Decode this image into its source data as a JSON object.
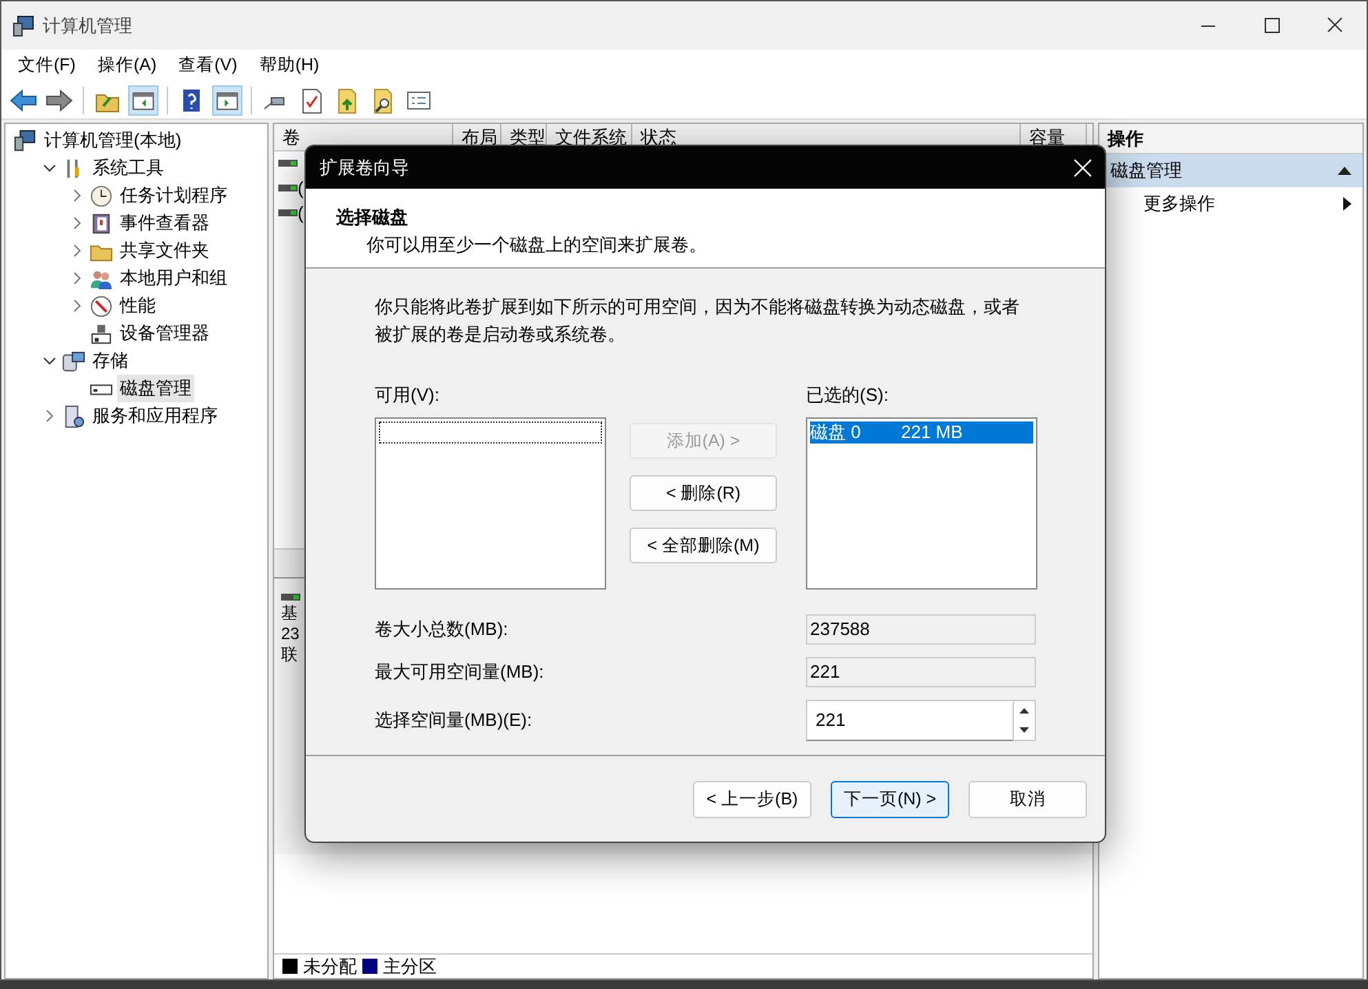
{
  "window": {
    "title": "计算机管理"
  },
  "menu": [
    "文件(F)",
    "操作(A)",
    "查看(V)",
    "帮助(H)"
  ],
  "tree": [
    {
      "label": "计算机管理(本地)",
      "selected": false,
      "children": [
        {
          "label": "系统工具",
          "expanded": true,
          "selected": false,
          "children": [
            {
              "label": "任务计划程序",
              "expanded": false,
              "selected": false
            },
            {
              "label": "事件查看器",
              "expanded": false,
              "selected": false
            },
            {
              "label": "共享文件夹",
              "expanded": false,
              "selected": false
            },
            {
              "label": "本地用户和组",
              "expanded": false,
              "selected": false
            },
            {
              "label": "性能",
              "expanded": false,
              "selected": false
            },
            {
              "label": "设备管理器",
              "selected": false
            }
          ]
        },
        {
          "label": "存储",
          "expanded": true,
          "selected": false,
          "children": [
            {
              "label": "磁盘管理",
              "selected": true
            }
          ]
        },
        {
          "label": "服务和应用程序",
          "expanded": false,
          "selected": false
        }
      ]
    }
  ],
  "volume_table": {
    "columns": [
      "卷",
      "布局",
      "类型",
      "文件系统",
      "状态",
      "容量"
    ],
    "rows": [
      {
        "column_1": ""
      },
      {
        "column_1": "("
      },
      {
        "column_1": "("
      }
    ]
  },
  "disk_panel": {
    "lines": [
      "基",
      "23",
      "联"
    ]
  },
  "legend": [
    {
      "label": "未分配",
      "color": "#000000"
    },
    {
      "label": "主分区",
      "color": "#000080"
    }
  ],
  "actions": {
    "title": "操作",
    "sections": [
      {
        "title": "磁盘管理",
        "expanded": true,
        "items": [
          "更多操作"
        ]
      }
    ]
  },
  "dialog": {
    "title": "扩展卷向导",
    "heading": "选择磁盘",
    "subtitle": "你可以用至少一个磁盘上的空间来扩展卷。",
    "description": "你只能将此卷扩展到如下所示的可用空间，因为不能将磁盘转换为动态磁盘，或者被扩展的卷是启动卷或系统卷。",
    "available_label": "可用(V):",
    "selected_label": "已选的(S):",
    "selected_disks": [
      {
        "disk": "磁盘 0",
        "size": "221 MB",
        "selected": true
      }
    ],
    "move_buttons": [
      {
        "label": "添加(A) >",
        "disabled": true
      },
      {
        "label": "< 删除(R)",
        "disabled": false
      },
      {
        "label": "< 全部删除(M)",
        "disabled": false
      }
    ],
    "fields": [
      {
        "label": "卷大小总数(MB):",
        "value": "237588",
        "kind": "readonly"
      },
      {
        "label": "最大可用空间量(MB):",
        "value": "221",
        "kind": "readonly"
      },
      {
        "label": "选择空间量(MB)(E):",
        "value": "221",
        "kind": "spin"
      }
    ],
    "footer_buttons": [
      {
        "label": "< 上一步(B)",
        "default": false
      },
      {
        "label": "下一页(N) >",
        "default": true
      },
      {
        "label": "取消",
        "default": false
      }
    ]
  }
}
